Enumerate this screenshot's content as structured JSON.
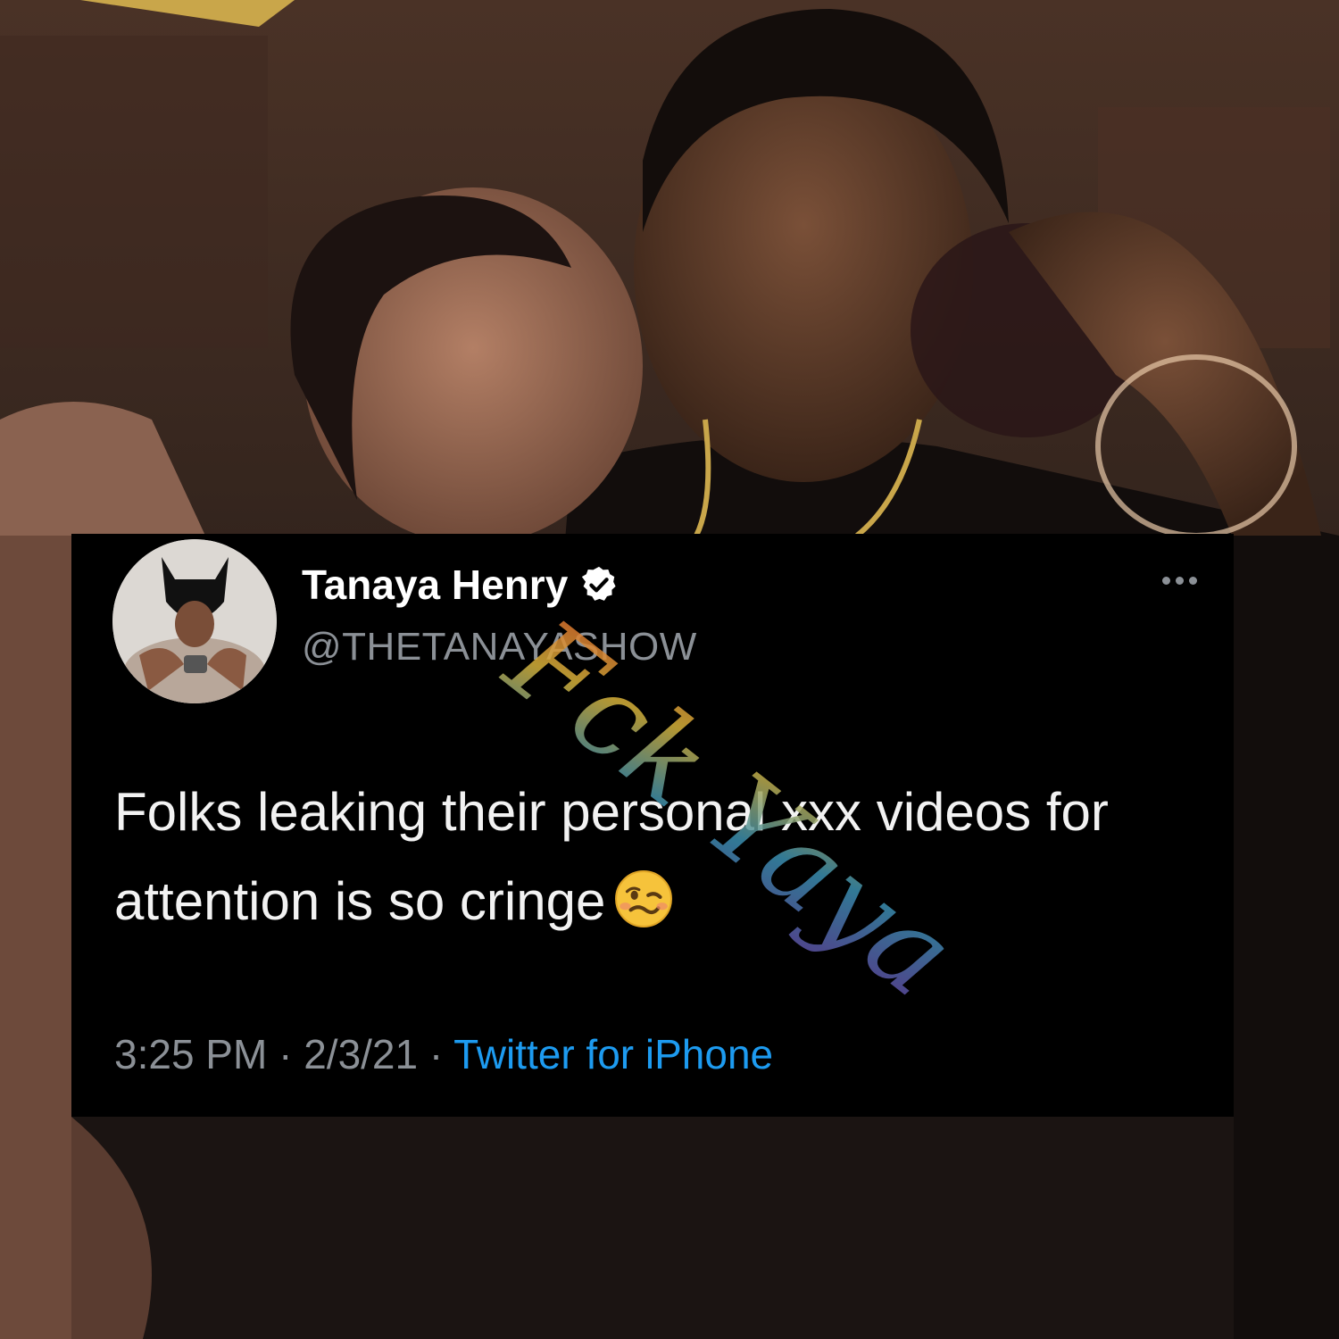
{
  "tweet": {
    "display_name": "Tanaya Henry",
    "handle": "@THETANAYASHOW",
    "text": "Folks leaking their personal xxx videos for attention is so cringe",
    "emoji": "woozy-face-emoji",
    "time": "3:25 PM",
    "date": "2/3/21",
    "separator": "·",
    "source": "Twitter for iPhone",
    "verified_icon": "verified-badge-icon",
    "more_icon": "more-options-icon"
  },
  "watermark": {
    "text": "Fck Yaya"
  },
  "colors": {
    "card_background": "#000000",
    "handle_gray": "#8b9096",
    "link_blue": "#1d9bf0",
    "verified_badge": "#ffffff"
  }
}
